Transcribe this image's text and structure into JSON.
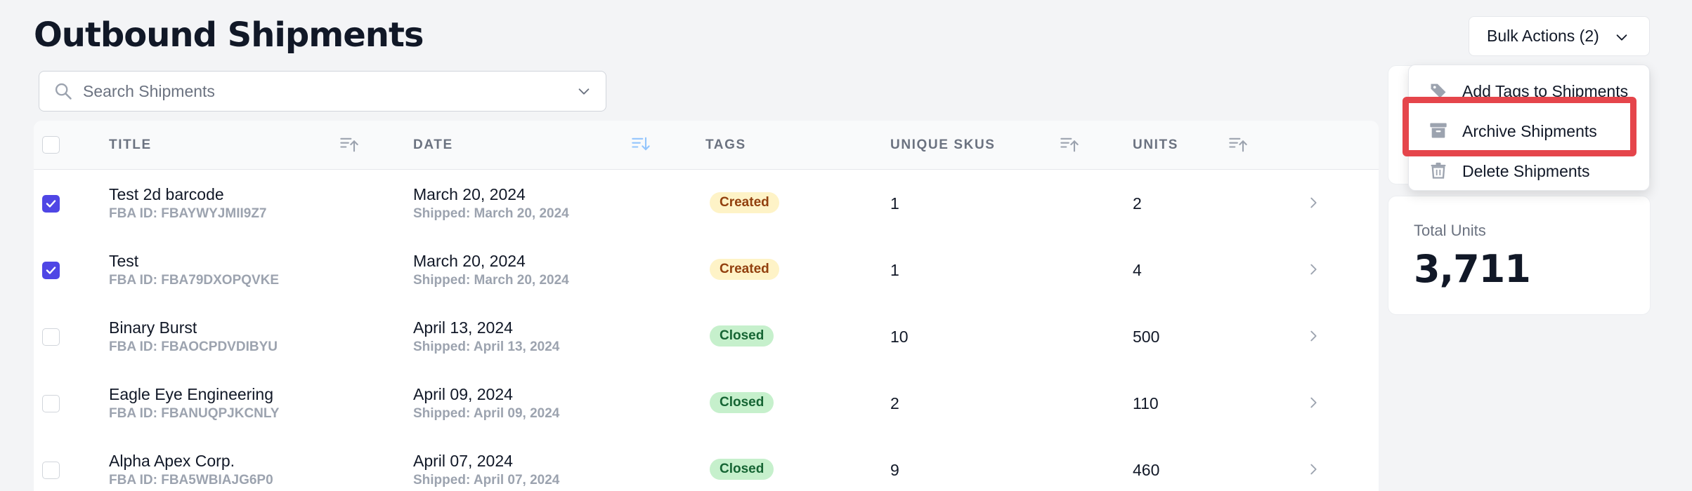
{
  "page": {
    "title": "Outbound Shipments"
  },
  "search": {
    "placeholder": "Search Shipments"
  },
  "table": {
    "columns": [
      "TITLE",
      "DATE",
      "TAGS",
      "UNIQUE SKUS",
      "UNITS"
    ],
    "rows": [
      {
        "checked": true,
        "title": "Test 2d barcode",
        "fba_id": "FBA ID: FBAYWYJMII9Z7",
        "date": "March 20, 2024",
        "shipped": "Shipped: March 20, 2024",
        "tag": "Created",
        "unique_skus": "1",
        "units": "2"
      },
      {
        "checked": true,
        "title": "Test",
        "fba_id": "FBA ID: FBA79DXOPQVKE",
        "date": "March 20, 2024",
        "shipped": "Shipped: March 20, 2024",
        "tag": "Created",
        "unique_skus": "1",
        "units": "4"
      },
      {
        "checked": false,
        "title": "Binary Burst",
        "fba_id": "FBA ID: FBAOCPDVDIBYU",
        "date": "April 13, 2024",
        "shipped": "Shipped: April 13, 2024",
        "tag": "Closed",
        "unique_skus": "10",
        "units": "500"
      },
      {
        "checked": false,
        "title": "Eagle Eye Engineering",
        "fba_id": "FBA ID: FBANUQPJKCNLY",
        "date": "April 09, 2024",
        "shipped": "Shipped: April 09, 2024",
        "tag": "Closed",
        "unique_skus": "2",
        "units": "110"
      },
      {
        "checked": false,
        "title": "Alpha Apex Corp.",
        "fba_id": "FBA ID: FBA5WBIAJG6P0",
        "date": "April 07, 2024",
        "shipped": "Shipped: April 07, 2024",
        "tag": "Closed",
        "unique_skus": "9",
        "units": "460"
      }
    ]
  },
  "stats": {
    "total_units_label": "Total Units",
    "total_units_value": "3,711"
  },
  "bulk_actions": {
    "label": "Bulk Actions (2)",
    "menu": [
      {
        "label": "Add Tags to Shipments",
        "icon": "tag-icon"
      },
      {
        "label": "Archive Shipments",
        "icon": "archive-icon",
        "highlighted": true
      },
      {
        "label": "Delete Shipments",
        "icon": "trash-icon"
      }
    ]
  },
  "colors": {
    "accent": "#4f46e5",
    "created_bg": "#fef3c7",
    "created_text": "#92400e",
    "closed_bg": "#c6f0cc",
    "closed_text": "#166534",
    "highlight": "#e5454b"
  }
}
